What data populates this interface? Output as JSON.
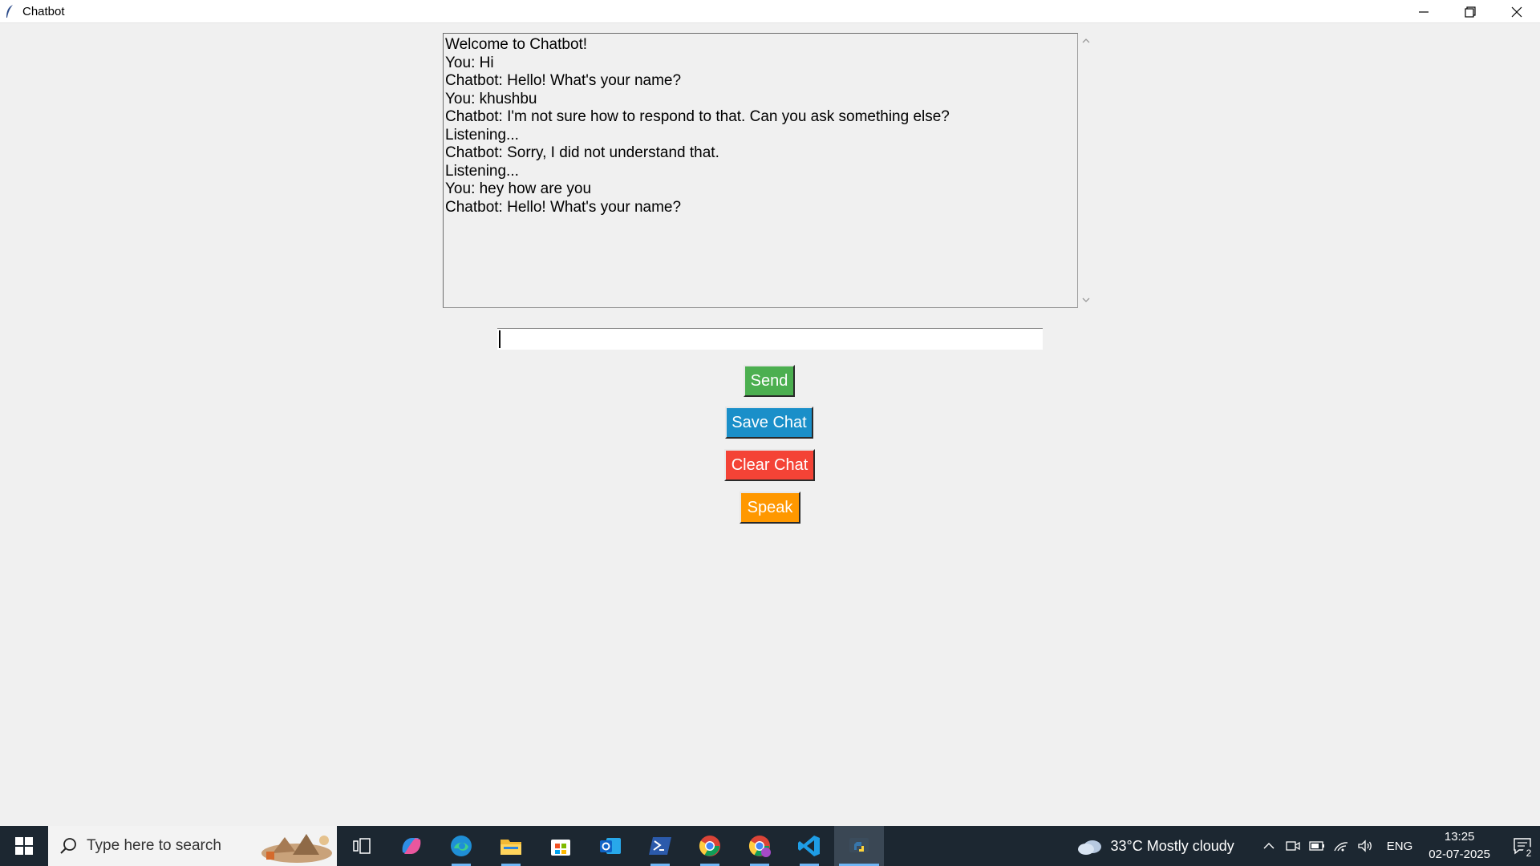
{
  "window": {
    "title": "Chatbot"
  },
  "chat": {
    "lines": [
      "Welcome to Chatbot!",
      "You: Hi",
      "Chatbot: Hello! What's your name?",
      "You: khushbu",
      "Chatbot: I'm not sure how to respond to that. Can you ask something else?",
      "Listening...",
      "Chatbot: Sorry, I did not understand that.",
      "Listening...",
      "You: hey how are you",
      "Chatbot: Hello! What's your name?"
    ],
    "input_value": ""
  },
  "buttons": {
    "send": "Send",
    "save": "Save Chat",
    "clear": "Clear Chat",
    "speak": "Speak"
  },
  "colors": {
    "send": "#4caf50",
    "save": "#1a8fc9",
    "clear": "#f44336",
    "speak": "#ff9800"
  },
  "taskbar": {
    "search_placeholder": "Type here to search",
    "apps": [
      "task-view-icon",
      "copilot-icon",
      "edge-icon",
      "file-explorer-icon",
      "microsoft-store-icon",
      "outlook-icon",
      "powershell-icon",
      "chrome-icon",
      "chrome-profile-icon",
      "vscode-icon",
      "python-icon"
    ],
    "weather": "33°C  Mostly cloudy",
    "language": "ENG",
    "time": "13:25",
    "date": "02-07-2025",
    "notification_count": "2"
  }
}
